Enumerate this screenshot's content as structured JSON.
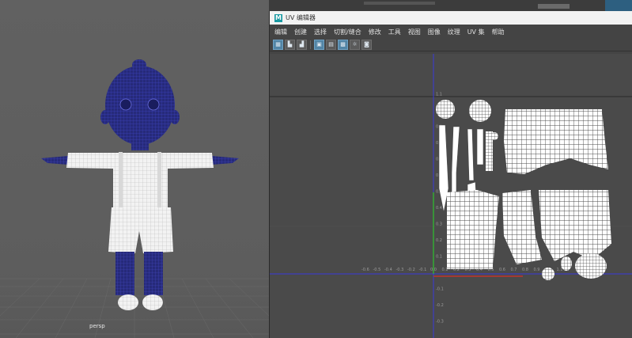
{
  "viewport": {
    "camera_label": "persp"
  },
  "background_strip": {
    "tabs": [
      "",
      "",
      ""
    ]
  },
  "uv_editor": {
    "title": "UV 编辑器",
    "logo_letter": "M",
    "menus": [
      "编辑",
      "创建",
      "选择",
      "切割/缝合",
      "修改",
      "工具",
      "视图",
      "图像",
      "纹理",
      "UV 集",
      "帮助"
    ],
    "toolbar_icons": [
      "uv-grid-icon",
      "uv-shell-icon",
      "uv-layout-icon",
      "checker-icon",
      "shaded-icon",
      "texture-icon",
      "sun-icon",
      "camera-icon"
    ],
    "axis_ticks": {
      "u_left": [
        "-0.6",
        "-0.5",
        "-0.4",
        "-0.3",
        "-0.2",
        "-0.1",
        "0.0",
        "0.1",
        "0.2",
        "0.3",
        "0.4",
        "0.5",
        "0.6",
        "0.7",
        "0.8",
        "0.9",
        "1.0",
        "1.1"
      ],
      "v": [
        "1.1",
        "1.0",
        "0.9",
        "0.8",
        "0.7",
        "0.6",
        "0.5",
        "0.4",
        "0.3",
        "0.2",
        "0.1",
        "-0.1",
        "-0.2",
        "-0.3",
        "-0.4"
      ]
    }
  },
  "colors": {
    "wire_blue": "#2a2f8a",
    "wire_white": "#ffffff",
    "u_axis": "#c0342c",
    "v_axis": "#2ec22e",
    "blue_line": "#3b3bd9",
    "accent_tool": "#5285a6"
  }
}
